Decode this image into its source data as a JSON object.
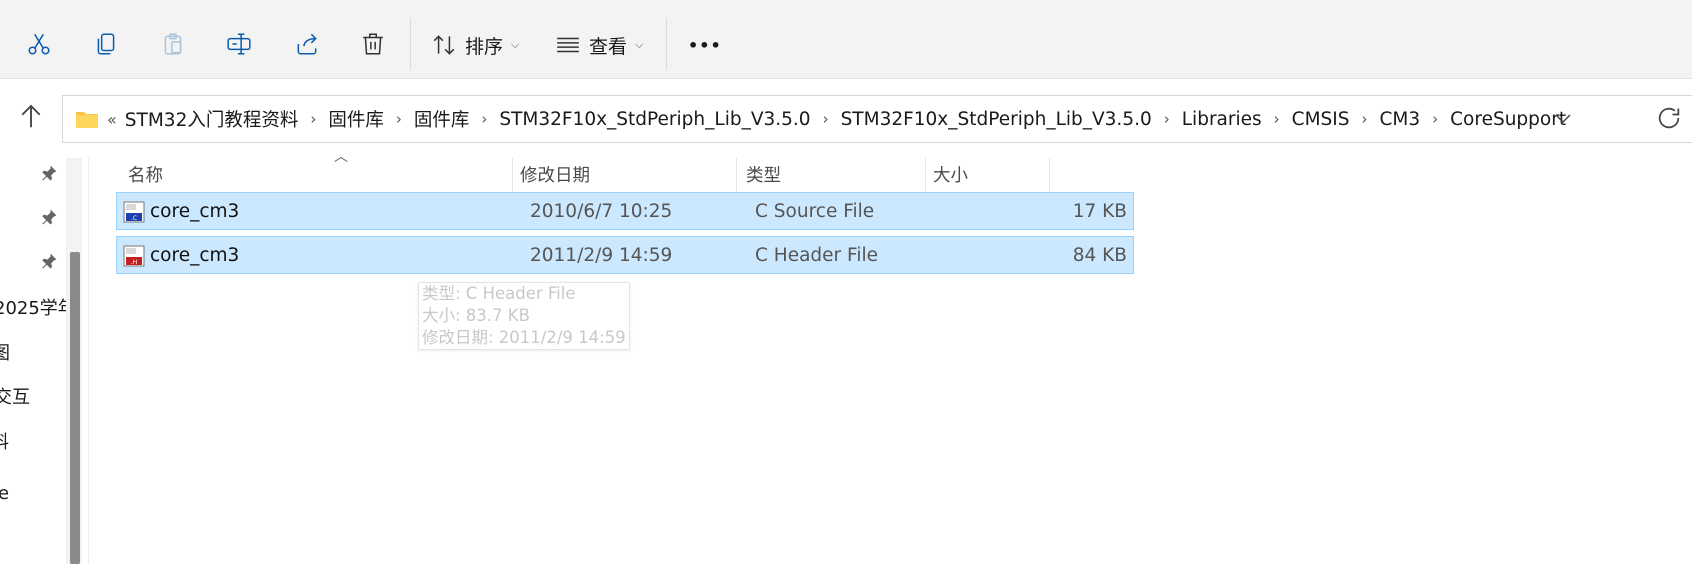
{
  "toolbar": {
    "buttons": [
      {
        "name": "cut",
        "icon": "scissors-icon"
      },
      {
        "name": "copy",
        "icon": "copy-icon"
      },
      {
        "name": "paste",
        "icon": "paste-icon"
      },
      {
        "name": "rename",
        "icon": "rename-icon"
      },
      {
        "name": "share",
        "icon": "share-icon"
      },
      {
        "name": "delete",
        "icon": "trash-icon"
      }
    ],
    "sort_label": "排序",
    "view_label": "查看",
    "more_label": "•••"
  },
  "address": {
    "overflow": "«",
    "crumbs": [
      "STM32入门教程资料",
      "固件库",
      "固件库",
      "STM32F10x_StdPeriph_Lib_V3.5.0",
      "STM32F10x_StdPeriph_Lib_V3.5.0",
      "Libraries",
      "CMSIS",
      "CM3",
      "CoreSupport"
    ],
    "separator": "›"
  },
  "nav_pane": {
    "items": [
      "2025学年",
      "图",
      "交互",
      "料",
      "e"
    ]
  },
  "columns": {
    "name": "名称",
    "date": "修改日期",
    "type": "类型",
    "size": "大小"
  },
  "files": [
    {
      "name": "core_cm3",
      "date": "2010/6/7 10:25",
      "type": "C Source File",
      "size": "17 KB",
      "icon": "c-source-file-icon",
      "selected": true
    },
    {
      "name": "core_cm3",
      "date": "2011/2/9 14:59",
      "type": "C Header File",
      "size": "84 KB",
      "icon": "c-header-file-icon",
      "selected": true
    }
  ],
  "tooltip": {
    "line1": "类型: C Header File",
    "line2": "大小: 83.7 KB",
    "line3": "修改日期: 2011/2/9 14:59"
  },
  "colors": {
    "selection_bg": "#cce8ff",
    "selection_border": "#99d1ff",
    "toolbar_bg": "#f3f3f3",
    "accent": "#0067c0"
  }
}
